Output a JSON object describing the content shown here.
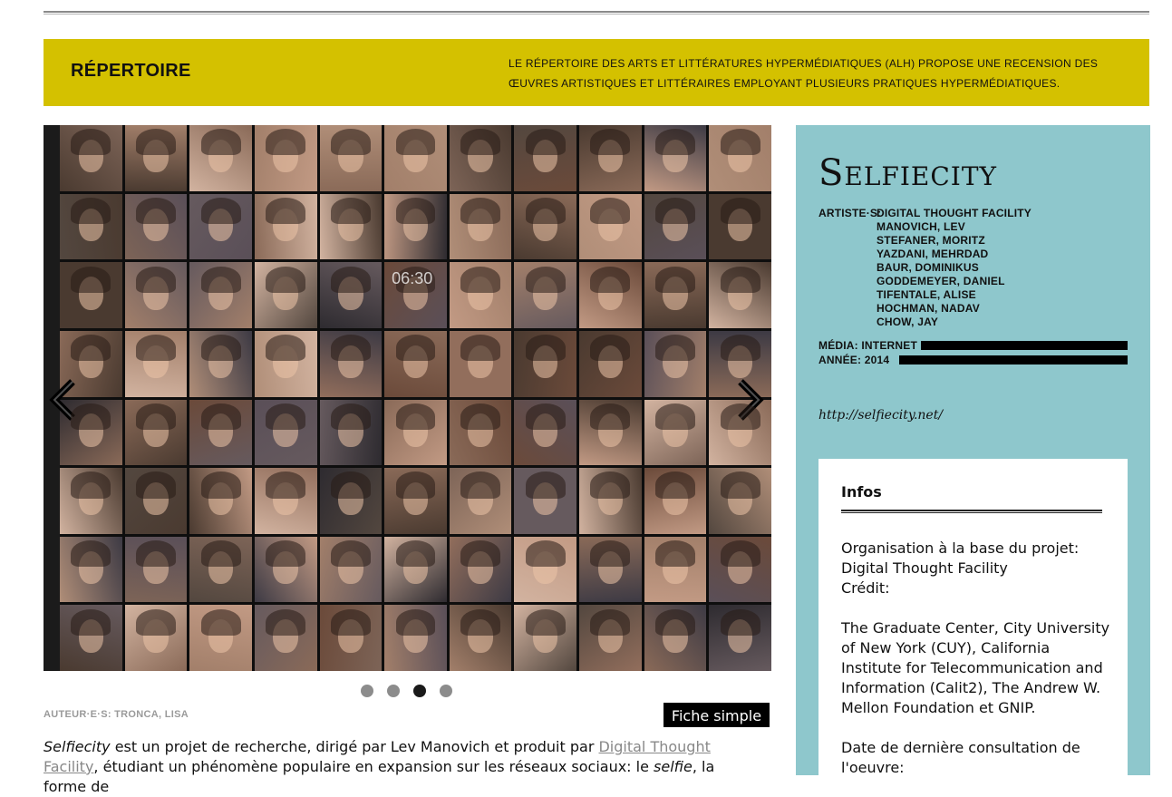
{
  "header": {
    "title": "RÉPERTOIRE",
    "description": "LE RÉPERTOIRE DES ARTS ET LITTÉRATURES HYPERMÉDIATIQUES (ALH) PROPOSE UNE RECENSION DES ŒUVRES ARTISTIQUES ET LITTÉRAIRES EMPLOYANT PLUSIEURS PRATIQUES HYPERMÉDIATIQUES."
  },
  "slider": {
    "prev_icon": "chevron-left-icon",
    "next_icon": "chevron-right-icon",
    "slide_count": 4,
    "active_slide": 3,
    "clock_overlay": "06:30"
  },
  "work": {
    "author_line": "AUTEUR·E·S: TRONCA, LISA",
    "fiche_button": "Fiche simple",
    "intro_em": "Selfiecity",
    "intro_1": " est un projet de recherche, dirigé par Lev Manovich et produit par ",
    "intro_link": "Digital Thought Facility",
    "intro_2": ", étudiant un phénomène populaire en expansion sur les réseaux sociaux: le ",
    "intro_em2": "selfie",
    "intro_3": ", la forme de"
  },
  "sidebar": {
    "title": "Selfiecity",
    "artists_label": "ARTISTE·S:",
    "artists": [
      "DIGITAL THOUGHT FACILITY",
      "MANOVICH, LEV",
      "STEFANER, MORITZ",
      "YAZDANI, MEHRDAD",
      "BAUR, DOMINIKUS",
      "GODDEMEYER, DANIEL",
      "TIFENTALE, ALISE",
      "HOCHMAN, NADAV",
      "CHOW, JAY"
    ],
    "media": "MÉDIA: INTERNET",
    "year": "ANNÉE: 2014",
    "url": "http://selfiecity.net/"
  },
  "infos": {
    "title": "Infos",
    "org_label": "Organisation à la base du projet:",
    "org_value": "Digital Thought Facility",
    "credit_label": "Crédit:",
    "credit_value": "The Graduate Center, City University of New York (CUY), California Institute for Telecommunication and Information (Calit2), The Andrew W. Mellon Foundation et GNIP.",
    "date_label": "Date de dernière consultation de l'oeuvre:"
  },
  "colors": {
    "banner": "#d4c100",
    "sidebar": "#8ec7cc",
    "button_bg": "#000000"
  }
}
